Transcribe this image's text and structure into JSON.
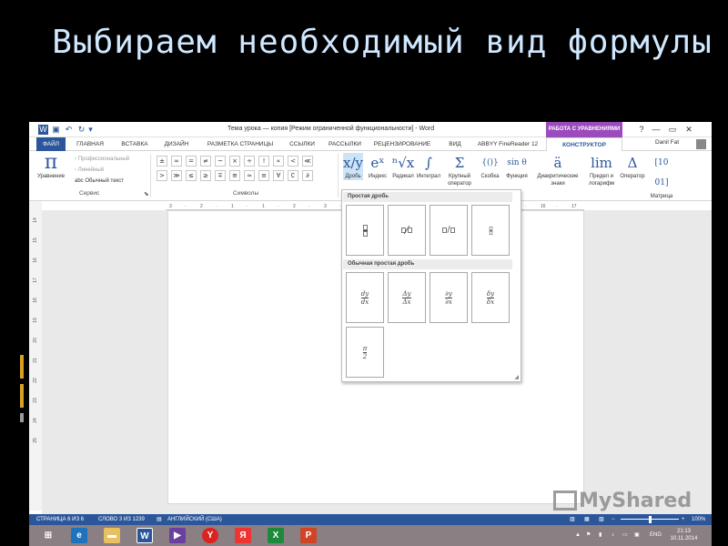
{
  "slide": {
    "title": "Выбираем необходимый вид формулы"
  },
  "titlebar": {
    "doc_title": "Тема урока — копия [Режим ограниченной функциональности] - Word",
    "eq_tools": "РАБОТА С УРАВНЕНИЯМИ",
    "help": "?",
    "minimize": "—",
    "restore": "▭",
    "close": "✕"
  },
  "tabs": [
    {
      "label": "ФАЙЛ"
    },
    {
      "label": "ГЛАВНАЯ"
    },
    {
      "label": "ВСТАВКА"
    },
    {
      "label": "ДИЗАЙН"
    },
    {
      "label": "РАЗМЕТКА СТРАНИЦЫ"
    },
    {
      "label": "ССЫЛКИ"
    },
    {
      "label": "РАССЫЛКИ"
    },
    {
      "label": "РЕЦЕНЗИРОВАНИЕ"
    },
    {
      "label": "ВИД"
    },
    {
      "label": "ABBYY FineReader 12"
    },
    {
      "label": "КОНСТРУКТОР"
    }
  ],
  "user": {
    "name": "Danil Fat"
  },
  "ribbon": {
    "equation": {
      "glyph": "π",
      "label": "Уравнение"
    },
    "service": {
      "professional": "Профессиональный",
      "linear": "Линейный",
      "normal_text": "Обычный текст",
      "group_label": "Сервис"
    },
    "symbols": {
      "row1": [
        "±",
        "∞",
        "=",
        "≠",
        "~",
        "×",
        "÷",
        "!",
        "∝",
        "<",
        "≪"
      ],
      "row2": [
        ">",
        "≫",
        "≤",
        "≥",
        "∓",
        "≅",
        "≈",
        "≡",
        "∀",
        "∁",
        "∂"
      ],
      "group_label": "Символы"
    },
    "structures": [
      {
        "glyph": "x/y",
        "label": "Дробь"
      },
      {
        "glyph": "eˣ",
        "label": "Индекс"
      },
      {
        "glyph": "ⁿ√x",
        "label": "Радикал"
      },
      {
        "glyph": "∫",
        "label": "Интеграл"
      },
      {
        "glyph": "Σ",
        "label": "Крупный оператор"
      },
      {
        "glyph": "{()}",
        "label": "Скобка"
      },
      {
        "glyph": "sin θ",
        "label": "Функция"
      },
      {
        "glyph": "ä",
        "label": "Диакритические знаки"
      },
      {
        "glyph": "lim",
        "label": "Предел и логарифм"
      },
      {
        "glyph": "Δ",
        "label": "Оператор"
      },
      {
        "glyph": "[10 01]",
        "label": "Матрица"
      }
    ]
  },
  "gallery": {
    "section1": "Простая дробь",
    "section2": "Обычная простая дробь",
    "common": [
      {
        "num": "dy",
        "den": "dx"
      },
      {
        "num": "Δy",
        "den": "Δx"
      },
      {
        "num": "∂y",
        "den": "∂x"
      },
      {
        "num": "δy",
        "den": "δx"
      },
      {
        "num": "π",
        "den": "2"
      }
    ],
    "skewed": "⁄",
    "linear": "/"
  },
  "ruler": {
    "h": [
      "3",
      "·",
      "2",
      "·",
      "1",
      "·",
      "1",
      "·",
      "2",
      "·",
      "3",
      "·",
      "4",
      "·",
      "5",
      "·",
      "6",
      "·",
      "7",
      "·",
      "8",
      "·",
      "15",
      "·",
      "16",
      "·",
      "17"
    ],
    "v": [
      "14",
      "15",
      "16",
      "17",
      "18",
      "19",
      "20",
      "21",
      "22",
      "23",
      "24",
      "25"
    ]
  },
  "statusbar": {
    "page": "СТРАНИЦА 6 ИЗ 6",
    "words": "СЛОВО 3 ИЗ 1239",
    "lang": "АНГЛИЙСКИЙ (США)",
    "zoom": "100%"
  },
  "taskbar": {
    "lang": "ENG",
    "time": "21:13",
    "date": "10.11.2014"
  },
  "watermark": {
    "text": "MyShared"
  }
}
